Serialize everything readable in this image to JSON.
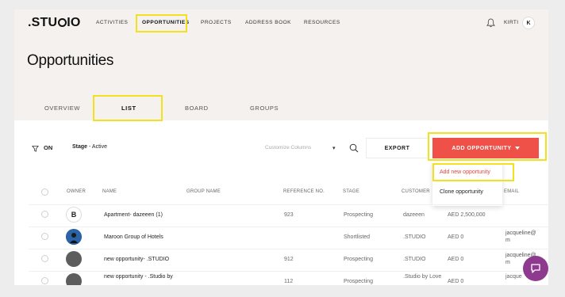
{
  "header": {
    "logo_text": ".STU",
    "logo_suffix": "IO",
    "nav": [
      {
        "label": "ACTIVITIES"
      },
      {
        "label": "OPPORTUNITIES"
      },
      {
        "label": "PROJECTS"
      },
      {
        "label": "ADDRESS BOOK"
      },
      {
        "label": "RESOURCES"
      }
    ],
    "user_name": "KIRTI",
    "user_initial": "K"
  },
  "page": {
    "title": "Opportunities",
    "tabs": [
      {
        "label": "OVERVIEW"
      },
      {
        "label": "LIST"
      },
      {
        "label": "BOARD"
      },
      {
        "label": "GROUPS"
      }
    ],
    "active_tab": "LIST"
  },
  "toolbar": {
    "filter_label": "ON",
    "stage_key": "Stage",
    "stage_value": " - Active",
    "columns_placeholder": "Customize Columns",
    "columns_caret": "▾",
    "export_label": "EXPORT",
    "add_label": "ADD OPPORTUNITY"
  },
  "dropdown": {
    "items": [
      {
        "label": "Add new opportunity"
      },
      {
        "label": "Clone opportunity"
      }
    ]
  },
  "table": {
    "headers": [
      "OWNER",
      "NAME",
      "GROUP NAME",
      "REFERENCE NO.",
      "STAGE",
      "CUSTOMER",
      "EMAIL"
    ],
    "rows": [
      {
        "owner": "B",
        "name": "Apartment- dazeeen (1)",
        "group": "",
        "ref": "923",
        "stage": "Prospecting",
        "customer": "dazeeen",
        "value": "AED 2,500,000",
        "email": ""
      },
      {
        "owner": "",
        "name": "Maroon Group of Hotels",
        "group": "",
        "ref": "",
        "stage": "Shortlisted",
        "customer": ".STUDIO",
        "value": "AED 0",
        "email": "jacqueline@ m"
      },
      {
        "owner": "",
        "name": "new opportunity- .STUDIO",
        "group": "",
        "ref": "912",
        "stage": "Prospecting",
        "customer": ".STUDIO",
        "value": "AED 0",
        "email": "jacqueline@ m"
      },
      {
        "owner": "",
        "name": "new opportunity - .Studio by",
        "group": "",
        "ref": "112",
        "stage": "Prospecting",
        "customer": ".Studio by Love",
        "value": "AED 0",
        "email": "jacque"
      }
    ]
  },
  "colors": {
    "accent": "#ef5148",
    "highlight": "#f3e01f",
    "chat": "#8e3b8f",
    "header_bg": "#f4f1ee"
  },
  "icons": {
    "bell": "bell-icon",
    "filter": "filter-icon",
    "search": "search-icon",
    "chat": "chat-icon"
  }
}
